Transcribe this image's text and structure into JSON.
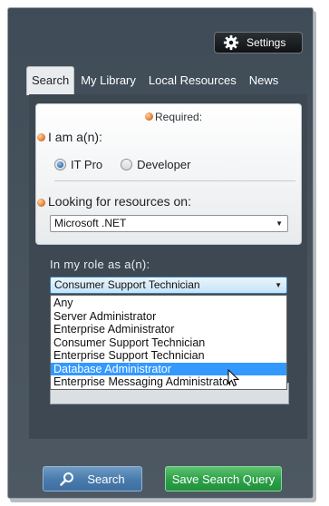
{
  "header": {
    "settings_label": "Settings"
  },
  "tabs": [
    {
      "label": "Search",
      "active": true
    },
    {
      "label": "My Library",
      "active": false
    },
    {
      "label": "Local Resources",
      "active": false
    },
    {
      "label": "News",
      "active": false
    }
  ],
  "form": {
    "required_label": "Required:",
    "iam_label": "I am a(n):",
    "roles_radio": [
      {
        "label": "IT Pro",
        "checked": true
      },
      {
        "label": "Developer",
        "checked": false
      }
    ],
    "looking_label": "Looking for resources on:",
    "resources_value": "Microsoft .NET",
    "role_label": "In my role as a(n):",
    "role_value": "Consumer Support Technician",
    "role_options": [
      "Any",
      "Server Administrator",
      "Enterprise Administrator",
      "Consumer Support Technician",
      "Enterprise Support Technician",
      "Database Administrator",
      "Enterprise Messaging Administrator"
    ],
    "highlighted_option": "Database Administrator"
  },
  "buttons": {
    "search_label": "Search",
    "save_label": "Save Search Query"
  },
  "icons": [
    "gear-icon",
    "search-icon",
    "required-icon",
    "chevron-down-icon",
    "mouse-cursor-icon"
  ],
  "colors": {
    "background": "#46525c",
    "selection": "#3399ff",
    "required": "#e07a2a",
    "search_button": "#4a7cae",
    "save_button": "#2ea24a"
  }
}
